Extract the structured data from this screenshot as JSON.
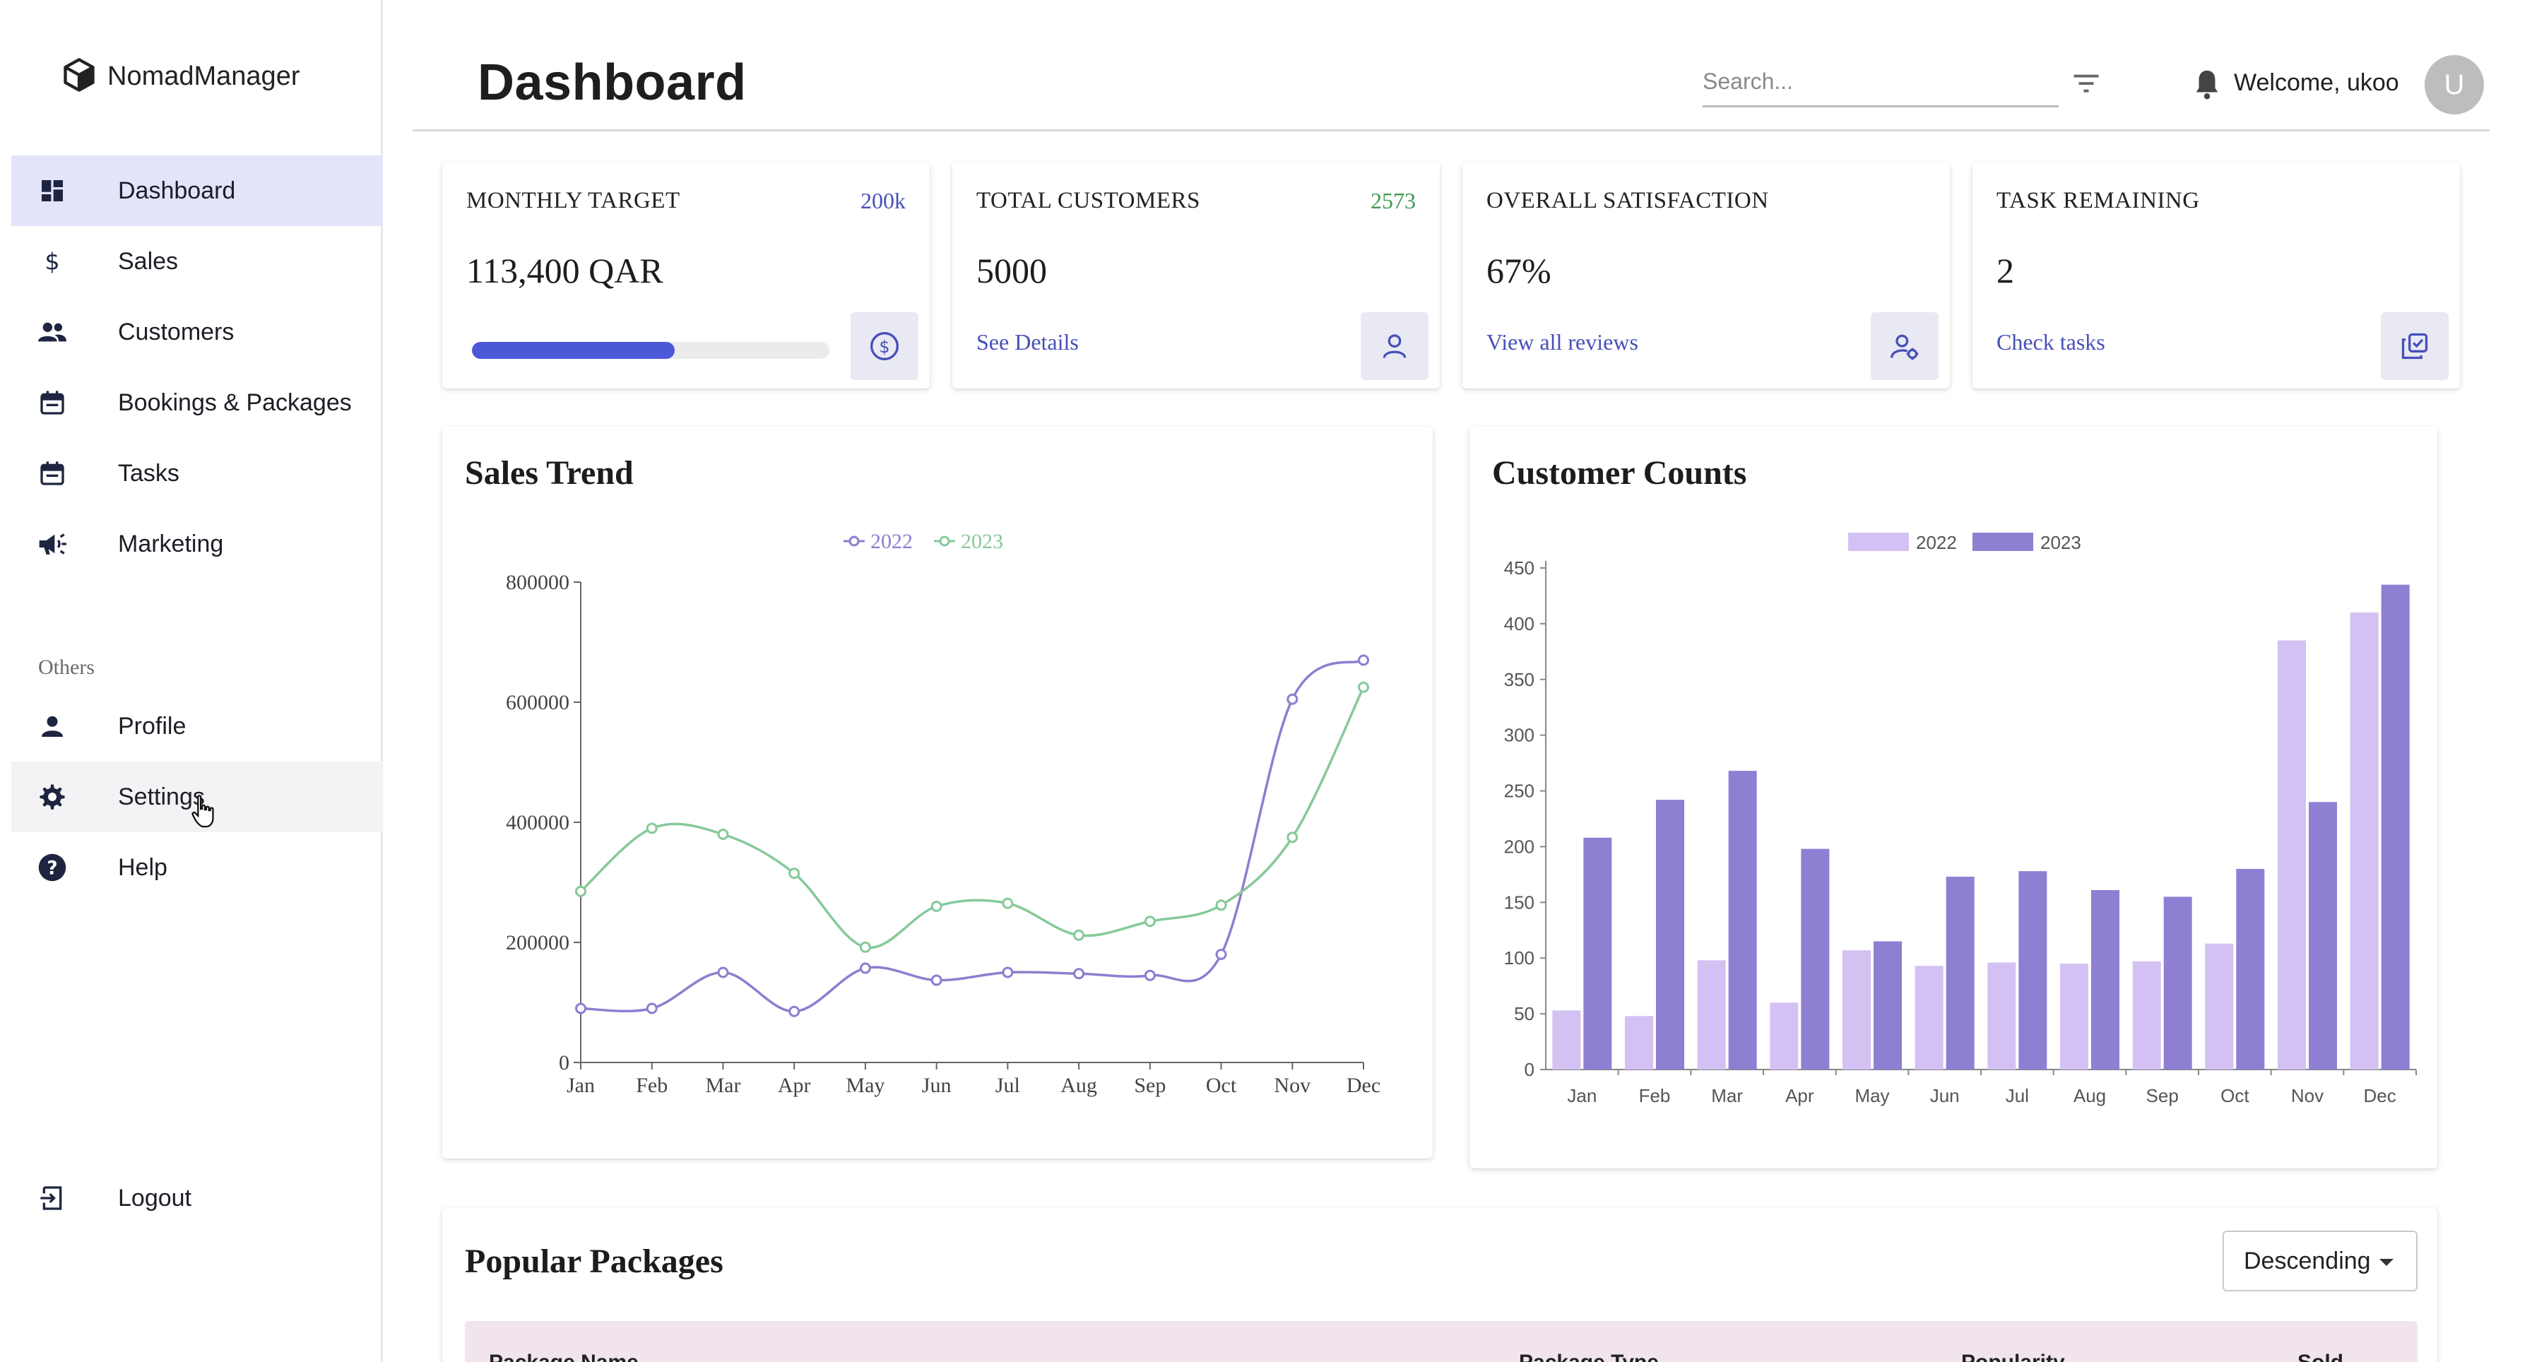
{
  "app": {
    "name": "NomadManager"
  },
  "sidebar": {
    "items": [
      {
        "label": "Dashboard",
        "icon": "dashboard-icon"
      },
      {
        "label": "Sales",
        "icon": "dollar-icon"
      },
      {
        "label": "Customers",
        "icon": "people-icon"
      },
      {
        "label": "Bookings & Packages",
        "icon": "calendar-icon"
      },
      {
        "label": "Tasks",
        "icon": "calendar-icon"
      },
      {
        "label": "Marketing",
        "icon": "megaphone-icon"
      }
    ],
    "section_label": "Others",
    "other_items": [
      {
        "label": "Profile",
        "icon": "person-icon"
      },
      {
        "label": "Settings",
        "icon": "gear-icon"
      },
      {
        "label": "Help",
        "icon": "help-icon"
      }
    ],
    "logout_label": "Logout"
  },
  "header": {
    "title": "Dashboard",
    "search_placeholder": "Search...",
    "welcome": "Welcome, ukoo",
    "avatar_initial": "U"
  },
  "kpis": [
    {
      "title": "MONTHLY TARGET",
      "side": "200k",
      "side_color": "#4650b8",
      "value": "113,400 QAR",
      "progress": 0.567
    },
    {
      "title": "TOTAL CUSTOMERS",
      "side": "2573",
      "side_color": "#3e9a52",
      "value": "5000",
      "link": "See Details"
    },
    {
      "title": "OVERALL SATISFACTION",
      "value": "67%",
      "link": "View all reviews"
    },
    {
      "title": "TASK REMAINING",
      "value": "2",
      "link": "Check tasks"
    }
  ],
  "chart_data": [
    {
      "type": "line",
      "title": "Sales Trend",
      "categories": [
        "Jan",
        "Feb",
        "Mar",
        "Apr",
        "May",
        "Jun",
        "Jul",
        "Aug",
        "Sep",
        "Oct",
        "Nov",
        "Dec"
      ],
      "series": [
        {
          "name": "2022",
          "color": "#8b7fd0",
          "values": [
            90000,
            90000,
            150000,
            85000,
            157000,
            137000,
            150000,
            148000,
            145000,
            180000,
            605000,
            670000
          ]
        },
        {
          "name": "2023",
          "color": "#86c99a",
          "values": [
            285000,
            390000,
            380000,
            315000,
            192000,
            260000,
            265000,
            212000,
            235000,
            262000,
            375000,
            625000
          ]
        }
      ],
      "ylim": [
        0,
        800000
      ],
      "yticks": [
        "0",
        "200000",
        "400000",
        "600000",
        "800000"
      ],
      "legend": "top-center"
    },
    {
      "type": "bar",
      "title": "Customer Counts",
      "categories": [
        "Jan",
        "Feb",
        "Mar",
        "Apr",
        "May",
        "Jun",
        "Jul",
        "Aug",
        "Sep",
        "Oct",
        "Nov",
        "Dec"
      ],
      "series": [
        {
          "name": "2022",
          "color": "#d4c1f3",
          "values": [
            53,
            48,
            98,
            60,
            107,
            93,
            96,
            95,
            97,
            113,
            385,
            410
          ]
        },
        {
          "name": "2023",
          "color": "#8e7fd2",
          "values": [
            208,
            242,
            268,
            198,
            115,
            173,
            178,
            161,
            155,
            180,
            240,
            435
          ]
        }
      ],
      "ylim": [
        0,
        450
      ],
      "yticks": [
        "0",
        "50",
        "100",
        "150",
        "200",
        "250",
        "300",
        "350",
        "400",
        "450"
      ],
      "legend": "top-center"
    }
  ],
  "packages": {
    "title": "Popular Packages",
    "sort_value": "Descending",
    "columns": [
      "Package Name",
      "Package Type",
      "Popularity",
      "Sold"
    ]
  }
}
